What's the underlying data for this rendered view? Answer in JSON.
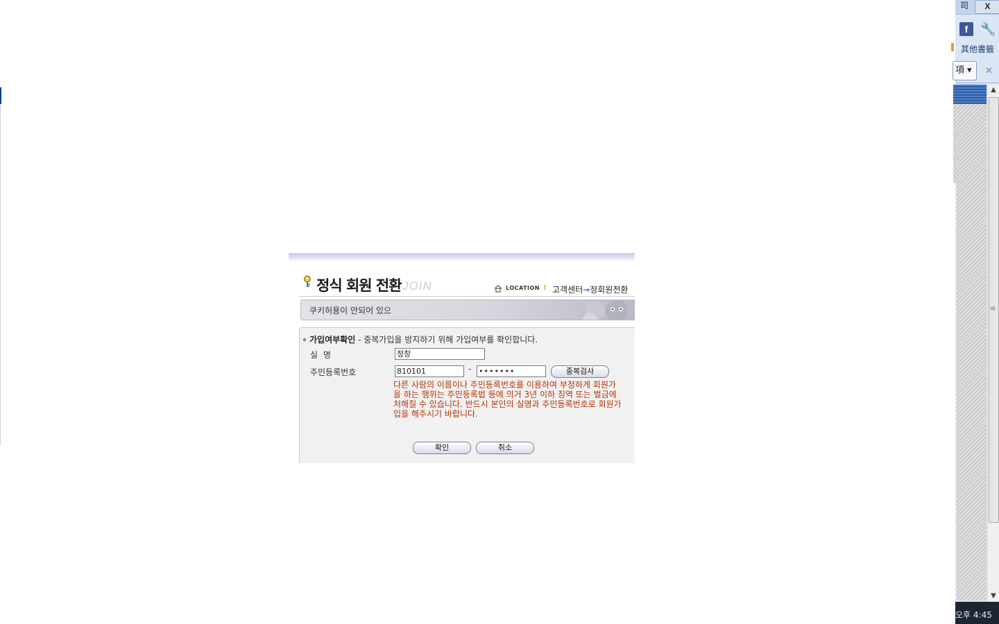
{
  "browser": {
    "restore_glyph": "司",
    "close_glyph": "X",
    "facebook_glyph": "f",
    "wrench_glyph": "🔧",
    "bookmarks_label": "其他書籤",
    "options_label": "項 ▾",
    "close_bar_glyph": "✕",
    "scroll_up": "▲",
    "scroll_down": "▼",
    "scroll_grip": "≡",
    "clock": "오후 4:45"
  },
  "dialog": {
    "title": "정식 회원 전환",
    "join_word": "JOIN",
    "location_label": "LOCATION",
    "location_bang": "!",
    "breadcrumb": {
      "first": "고객센터",
      "arrow": "→",
      "second": "정회원전환"
    },
    "notice": "쿠키허용이 안되어 있으",
    "form": {
      "heading_bold": "가입여부확인",
      "heading_rest": " - 중복가입을 방지하기 위해 가입여부를 확인합니다.",
      "name_label": "실 명",
      "name_value": "정창",
      "rrn_label": "주민등록번호",
      "rrn_first": "810101",
      "rrn_dash": "-",
      "rrn_second": "•••••••",
      "dup_check_button": "중복검사",
      "warning_lines": [
        "다른 사람의 이름이나 주민등록번호를 이용하여 부정하게 회원가",
        "을 하는 행위는 주민등록법 등에 의거 3년 이하 징역 또는 벌금에",
        "처해질 수 있습니다. 반드시 본인의 실명과 주민등록번호로 회원가",
        "입을 해주시기 바랍니다."
      ],
      "ok_button": "확인",
      "cancel_button": "취소"
    }
  },
  "colors": {
    "warning": "#b83200",
    "chrome_bg": "#dbe6f5",
    "accent_blue": "#2b5ea9"
  }
}
